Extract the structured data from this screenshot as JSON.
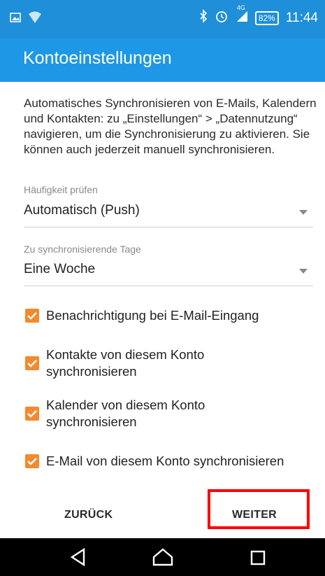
{
  "status_bar": {
    "network": "4G",
    "battery": "82%",
    "time": "11:44"
  },
  "app_bar": {
    "title": "Kontoeinstellungen"
  },
  "description": "Automatisches Synchronisieren von E-Mails, Kalendern und Kontakten: zu „Einstellungen“ > „Datennutzung“ navigieren, um die Synchronisierung zu aktivieren. Sie können auch jederzeit manuell synchronisieren.",
  "check_frequency": {
    "label": "Häufigkeit prüfen",
    "value": "Automatisch (Push)"
  },
  "sync_days": {
    "label": "Zu synchronisierende Tage",
    "value": "Eine Woche"
  },
  "checkboxes": [
    {
      "label": "Benachrichtigung bei E-Mail-Eingang",
      "checked": true
    },
    {
      "label": "Kontakte von diesem Konto synchronisieren",
      "checked": true
    },
    {
      "label": "Kalender von diesem Konto synchronisieren",
      "checked": true
    },
    {
      "label": "E-Mail von diesem Konto synchronisieren",
      "checked": true
    }
  ],
  "buttons": {
    "back": "ZURÜCK",
    "next": "WEITER"
  },
  "colors": {
    "status_bar": "#1e8fd8",
    "app_bar": "#1e97e6",
    "checkbox": "#f28a2e",
    "highlight": "#ff0000"
  }
}
